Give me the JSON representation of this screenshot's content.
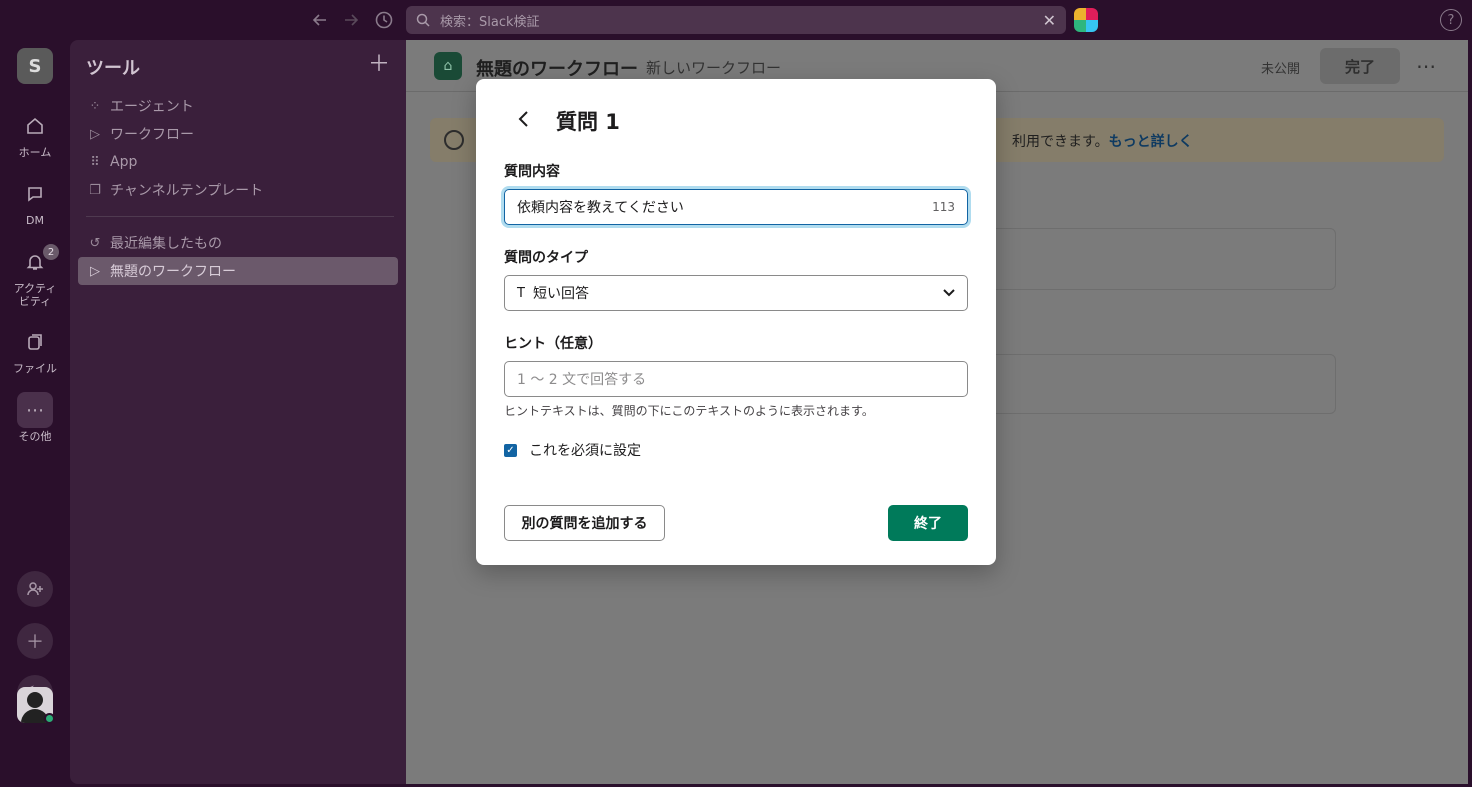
{
  "topbar": {
    "back_icon": "arrow-left-icon",
    "forward_icon": "arrow-right-icon",
    "history_icon": "clock-icon",
    "search_placeholder": "検索：Slack検証",
    "help_label": "?"
  },
  "rail": {
    "workspace_initial": "S",
    "items": [
      {
        "label": "ホーム",
        "icon": "home-icon"
      },
      {
        "label": "DM",
        "icon": "dm-icon"
      },
      {
        "label": "アクティビティ",
        "icon": "bell-icon",
        "badge": "2"
      },
      {
        "label": "ファイル",
        "icon": "files-icon"
      },
      {
        "label": "その他",
        "icon": "more-icon"
      }
    ]
  },
  "sidebar": {
    "title": "ツール",
    "items": [
      {
        "label": "エージェント",
        "icon": "agent-icon"
      },
      {
        "label": "ワークフロー",
        "icon": "play-icon"
      },
      {
        "label": "App",
        "icon": "grid-icon"
      },
      {
        "label": "チャンネルテンプレート",
        "icon": "template-icon"
      }
    ],
    "recent_label": "最近編集したもの",
    "recent_items": [
      {
        "label": "無題のワークフロー",
        "icon": "play-icon"
      }
    ]
  },
  "main": {
    "title": "無題のワークフロー",
    "subtitle": "新しいワークフロー",
    "status": "未公開",
    "done_label": "完了",
    "banner_text": "利用できます。",
    "banner_link": "もっと詳しく"
  },
  "modal": {
    "title": "質問 1",
    "question_label": "質問内容",
    "question_value": "依頼内容を教えてください",
    "question_count": "113",
    "type_label": "質問のタイプ",
    "type_icon": "T",
    "type_value": "短い回答",
    "hint_label": "ヒント（任意）",
    "hint_placeholder": "1 〜 2 文で回答する",
    "hint_note": "ヒントテキストは、質問の下にこのテキストのように表示されます。",
    "required_label": "これを必須に設定",
    "required_checked": true,
    "add_question_label": "別の質問を追加する",
    "finish_label": "終了"
  }
}
